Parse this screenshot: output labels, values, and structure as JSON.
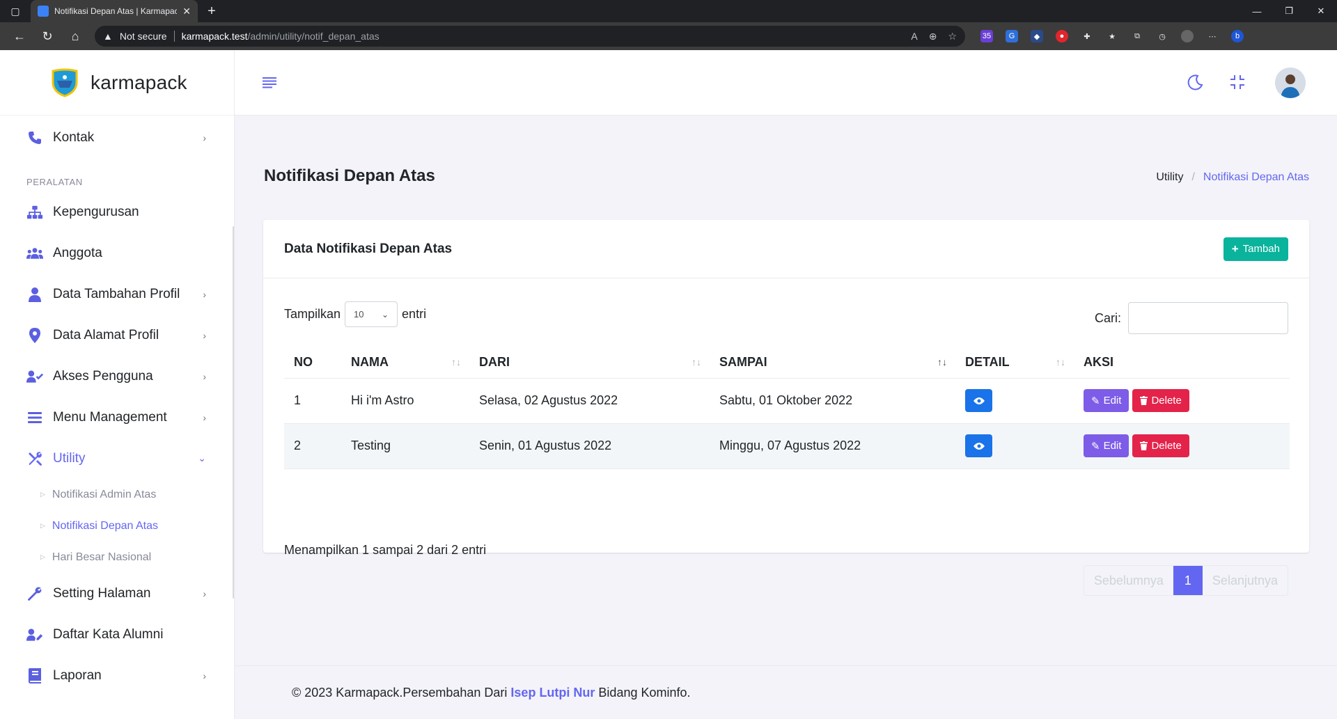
{
  "browser": {
    "tab_title": "Notifikasi Depan Atas | Karmapack",
    "security_label": "Not secure",
    "url_host": "karmapack.test",
    "url_path": "/admin/utility/notif_depan_atas",
    "extension_badge": "35"
  },
  "brand": {
    "name": "karmapack"
  },
  "sidebar": {
    "section_title": "PERALATAN",
    "items": {
      "kontak": "Kontak",
      "kepengurusan": "Kepengurusan",
      "anggota": "Anggota",
      "tambahan_profil": "Data Tambahan Profil",
      "alamat_profil": "Data Alamat Profil",
      "akses": "Akses Pengguna",
      "menu": "Menu Management",
      "utility": "Utility",
      "setting": "Setting Halaman",
      "alumni": "Daftar Kata Alumni",
      "laporan": "Laporan"
    },
    "utility_sub": {
      "admin_atas": "Notifikasi Admin Atas",
      "depan_atas": "Notifikasi Depan Atas",
      "hari_besar": "Hari Besar Nasional"
    }
  },
  "page": {
    "title": "Notifikasi Depan Atas",
    "breadcrumb_parent": "Utility",
    "breadcrumb_current": "Notifikasi Depan Atas"
  },
  "card": {
    "title": "Data Notifikasi Depan Atas",
    "add_label": "Tambah",
    "length_prefix": "Tampilkan",
    "length_value": "10",
    "length_suffix": "entri",
    "search_label": "Cari:",
    "search_value": ""
  },
  "table": {
    "headers": {
      "no": "NO",
      "nama": "NAMA",
      "dari": "DARI",
      "sampai": "SAMPAI",
      "detail": "DETAIL",
      "aksi": "AKSI"
    },
    "rows": [
      {
        "no": "1",
        "nama": "Hi i'm Astro",
        "dari": "Selasa, 02 Agustus 2022",
        "sampai": "Sabtu, 01 Oktober 2022"
      },
      {
        "no": "2",
        "nama": "Testing",
        "dari": "Senin, 01 Agustus 2022",
        "sampai": "Minggu, 07 Agustus 2022"
      }
    ],
    "edit_label": "Edit",
    "delete_label": "Delete"
  },
  "pagination": {
    "info": "Menampilkan 1 sampai 2 dari 2 entri",
    "prev": "Sebelumnya",
    "current": "1",
    "next": "Selanjutnya"
  },
  "footer": {
    "prefix": "© 2023 Karmapack.Persembahan Dari ",
    "author": "Isep Lutpi Nur",
    "suffix": " Bidang Kominfo."
  },
  "colors": {
    "primary": "#6366f1",
    "success": "#0ab39c",
    "info": "#1a73e8",
    "edit": "#7d5ce8",
    "danger": "#e4234a"
  }
}
